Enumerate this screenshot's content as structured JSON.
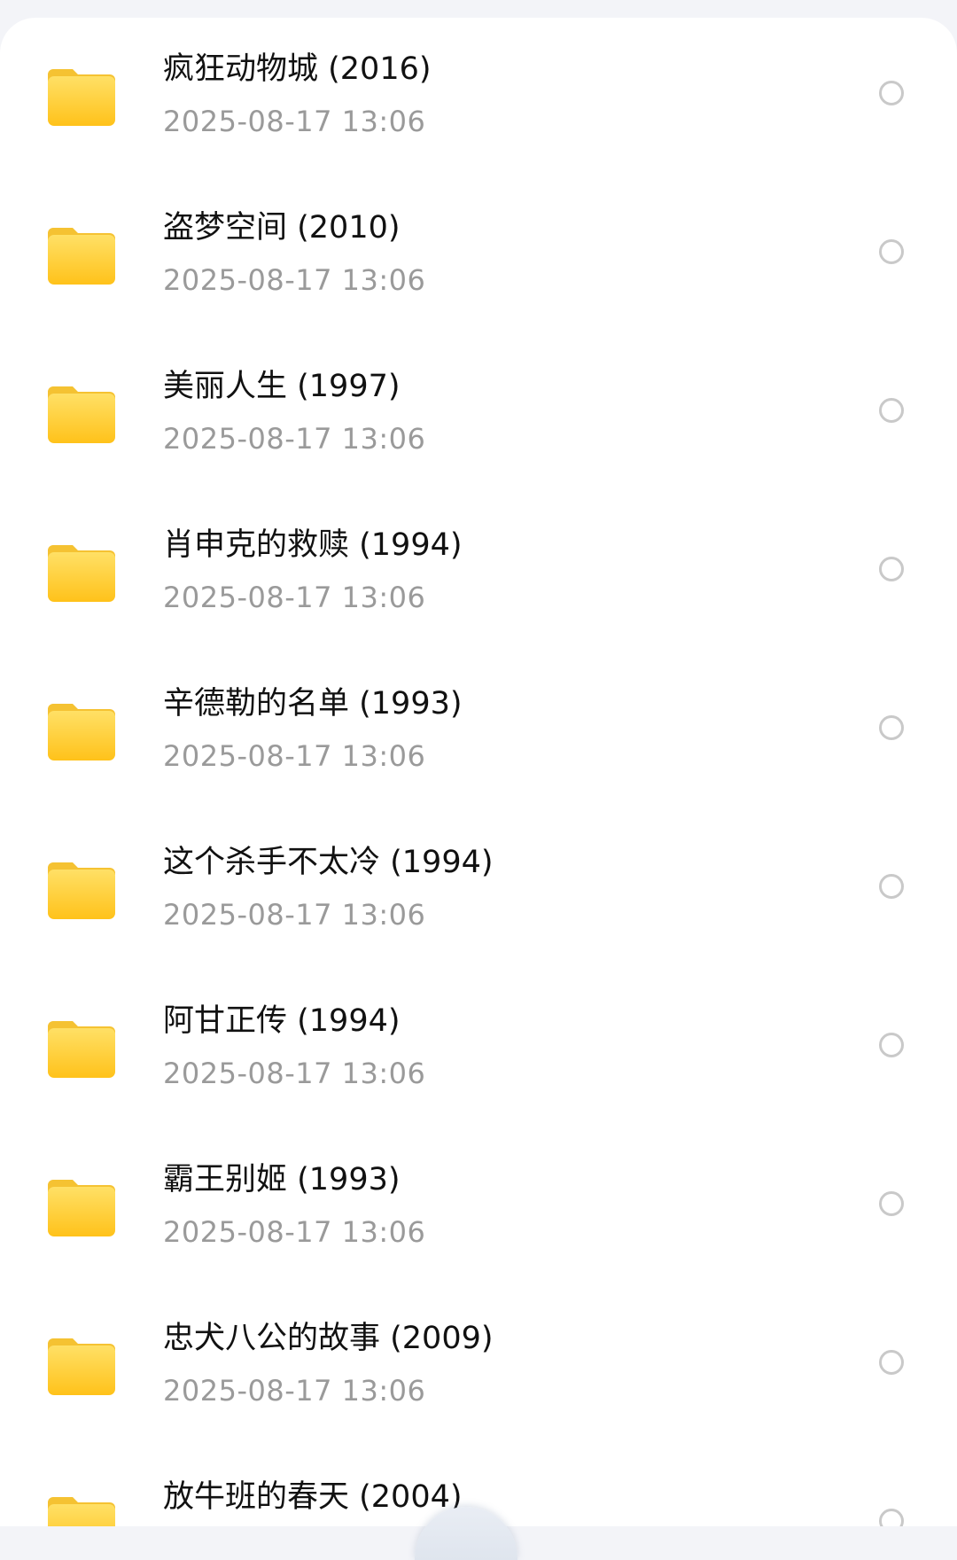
{
  "files": {
    "items": [
      {
        "name": "疯狂动物城 (2016)",
        "date": "2025-08-17  13:06",
        "icon": "folder-icon"
      },
      {
        "name": "盗梦空间 (2010)",
        "date": "2025-08-17  13:06",
        "icon": "folder-icon"
      },
      {
        "name": "美丽人生 (1997)",
        "date": "2025-08-17  13:06",
        "icon": "folder-icon"
      },
      {
        "name": "肖申克的救赎 (1994)",
        "date": "2025-08-17  13:06",
        "icon": "folder-icon"
      },
      {
        "name": "辛德勒的名单 (1993)",
        "date": "2025-08-17  13:06",
        "icon": "folder-icon"
      },
      {
        "name": "这个杀手不太冷 (1994)",
        "date": "2025-08-17  13:06",
        "icon": "folder-icon"
      },
      {
        "name": "阿甘正传 (1994)",
        "date": "2025-08-17  13:06",
        "icon": "folder-icon"
      },
      {
        "name": "霸王别姬 (1993)",
        "date": "2025-08-17  13:06",
        "icon": "folder-icon"
      },
      {
        "name": "忠犬八公的故事 (2009)",
        "date": "2025-08-17  13:06",
        "icon": "folder-icon"
      },
      {
        "name": "放牛班的春天 (2004)",
        "date": "",
        "icon": "folder-icon"
      }
    ]
  },
  "colors": {
    "folder_top": "#FFDD55",
    "folder_bottom": "#FFC21A",
    "folder_tab": "#F7C43A",
    "title_text": "#111111",
    "date_text": "#9A9A9A",
    "radio_border": "#C9C9C9",
    "background": "#F3F4F8"
  }
}
